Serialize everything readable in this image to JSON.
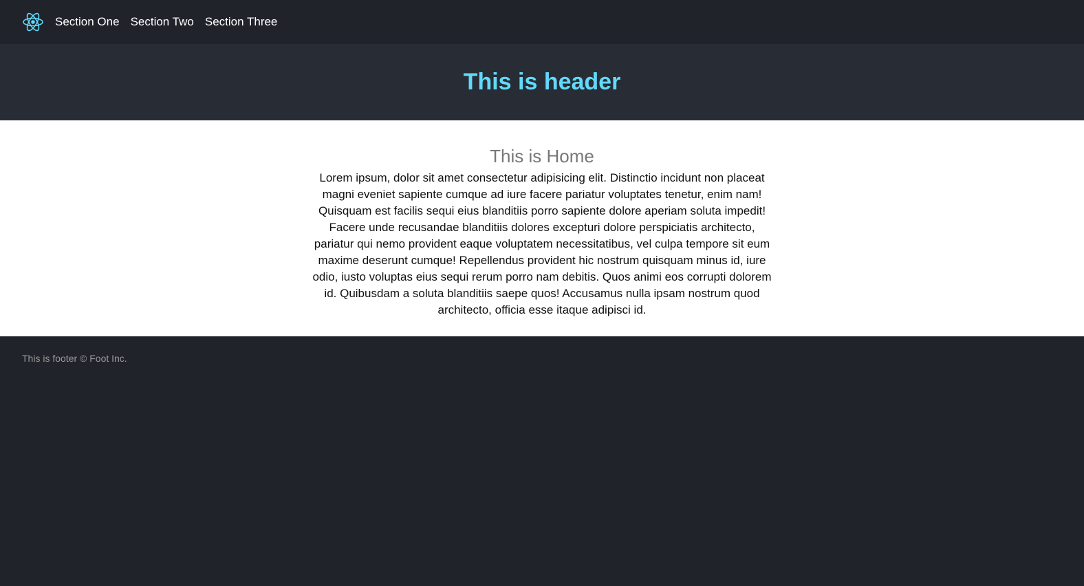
{
  "nav": {
    "logo_icon": "react-atom-icon",
    "links": [
      {
        "label": "Section One"
      },
      {
        "label": "Section Two"
      },
      {
        "label": "Section Three"
      }
    ]
  },
  "header": {
    "title": "This is header"
  },
  "home": {
    "title": "This is Home",
    "body": "Lorem ipsum, dolor sit amet consectetur adipisicing elit. Distinctio incidunt non placeat magni eveniet sapiente cumque ad iure facere pariatur voluptates tenetur, enim nam! Quisquam est facilis sequi eius blanditiis porro sapiente dolore aperiam soluta impedit! Facere unde recusandae blanditiis dolores excepturi dolore perspiciatis architecto, pariatur qui nemo provident eaque voluptatem necessitatibus, vel culpa tempore sit eum maxime deserunt cumque! Repellendus provident hic nostrum quisquam minus id, iure odio, iusto voluptas eius sequi rerum porro nam debitis. Quos animi eos corrupti dolorem id. Quibusdam a soluta blanditiis saepe quos! Accusamus nulla ipsam nostrum quod architecto, officia esse itaque adipisci id."
  },
  "footer": {
    "text": "This is footer © Foot Inc."
  },
  "colors": {
    "nav_bg": "#20232a",
    "header_bg": "#282c34",
    "accent": "#61dafb",
    "main_bg": "#ffffff"
  }
}
